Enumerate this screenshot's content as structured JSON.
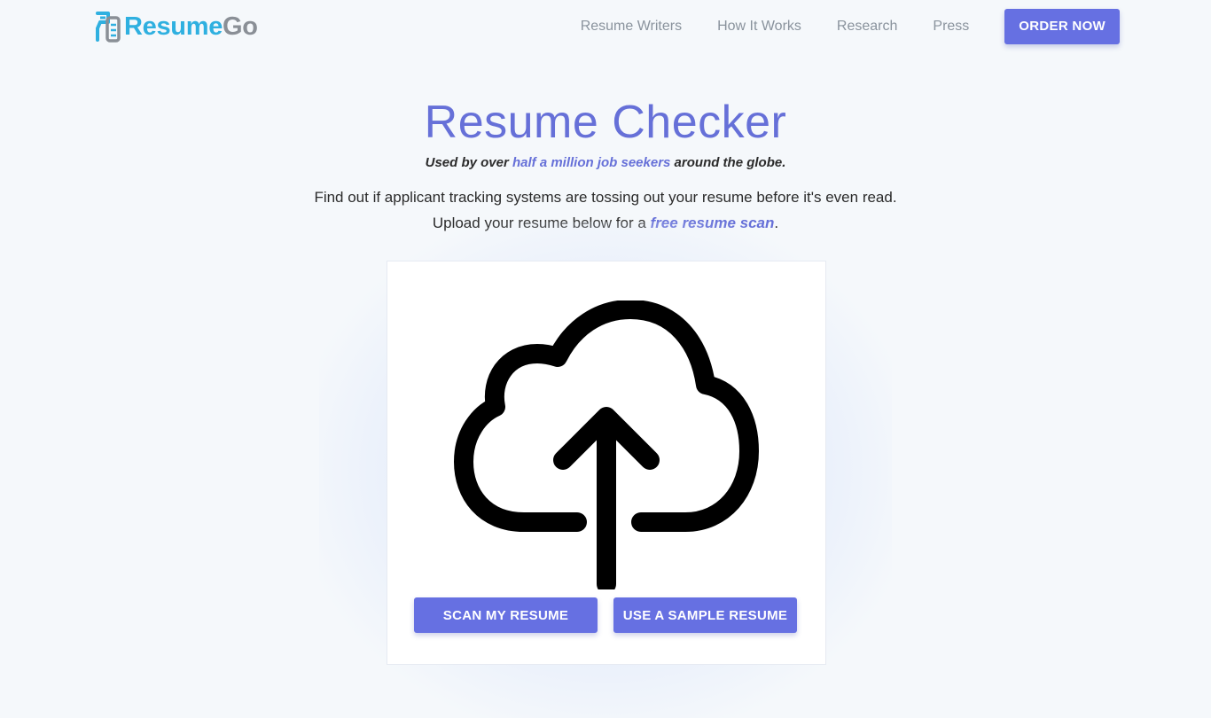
{
  "brand": {
    "name_part1": "Resume",
    "name_part2": "Go",
    "logo_icon": "resumego-logo-icon"
  },
  "nav": {
    "items": [
      {
        "label": "Resume Writers"
      },
      {
        "label": "How It Works"
      },
      {
        "label": "Research"
      },
      {
        "label": "Press"
      }
    ],
    "cta_label": "ORDER NOW"
  },
  "hero": {
    "title": "Resume Checker",
    "tagline_prefix": "Used by over ",
    "tagline_highlight": "half a million job seekers",
    "tagline_suffix": " around the globe.",
    "desc_line1": "Find out if applicant tracking systems are tossing out your resume before it's even read.",
    "desc_line2_prefix": "Upload your resume below for a ",
    "desc_line2_highlight": "free resume scan",
    "desc_line2_suffix": "."
  },
  "upload": {
    "icon": "cloud-upload-icon",
    "scan_label": "SCAN MY RESUME",
    "sample_label": "USE A SAMPLE RESUME"
  },
  "colors": {
    "accent": "#6670e2",
    "title": "#6670d8",
    "logo_blue": "#2fb0e0",
    "logo_gray": "#8a8f96",
    "background": "#f5f8fb"
  }
}
